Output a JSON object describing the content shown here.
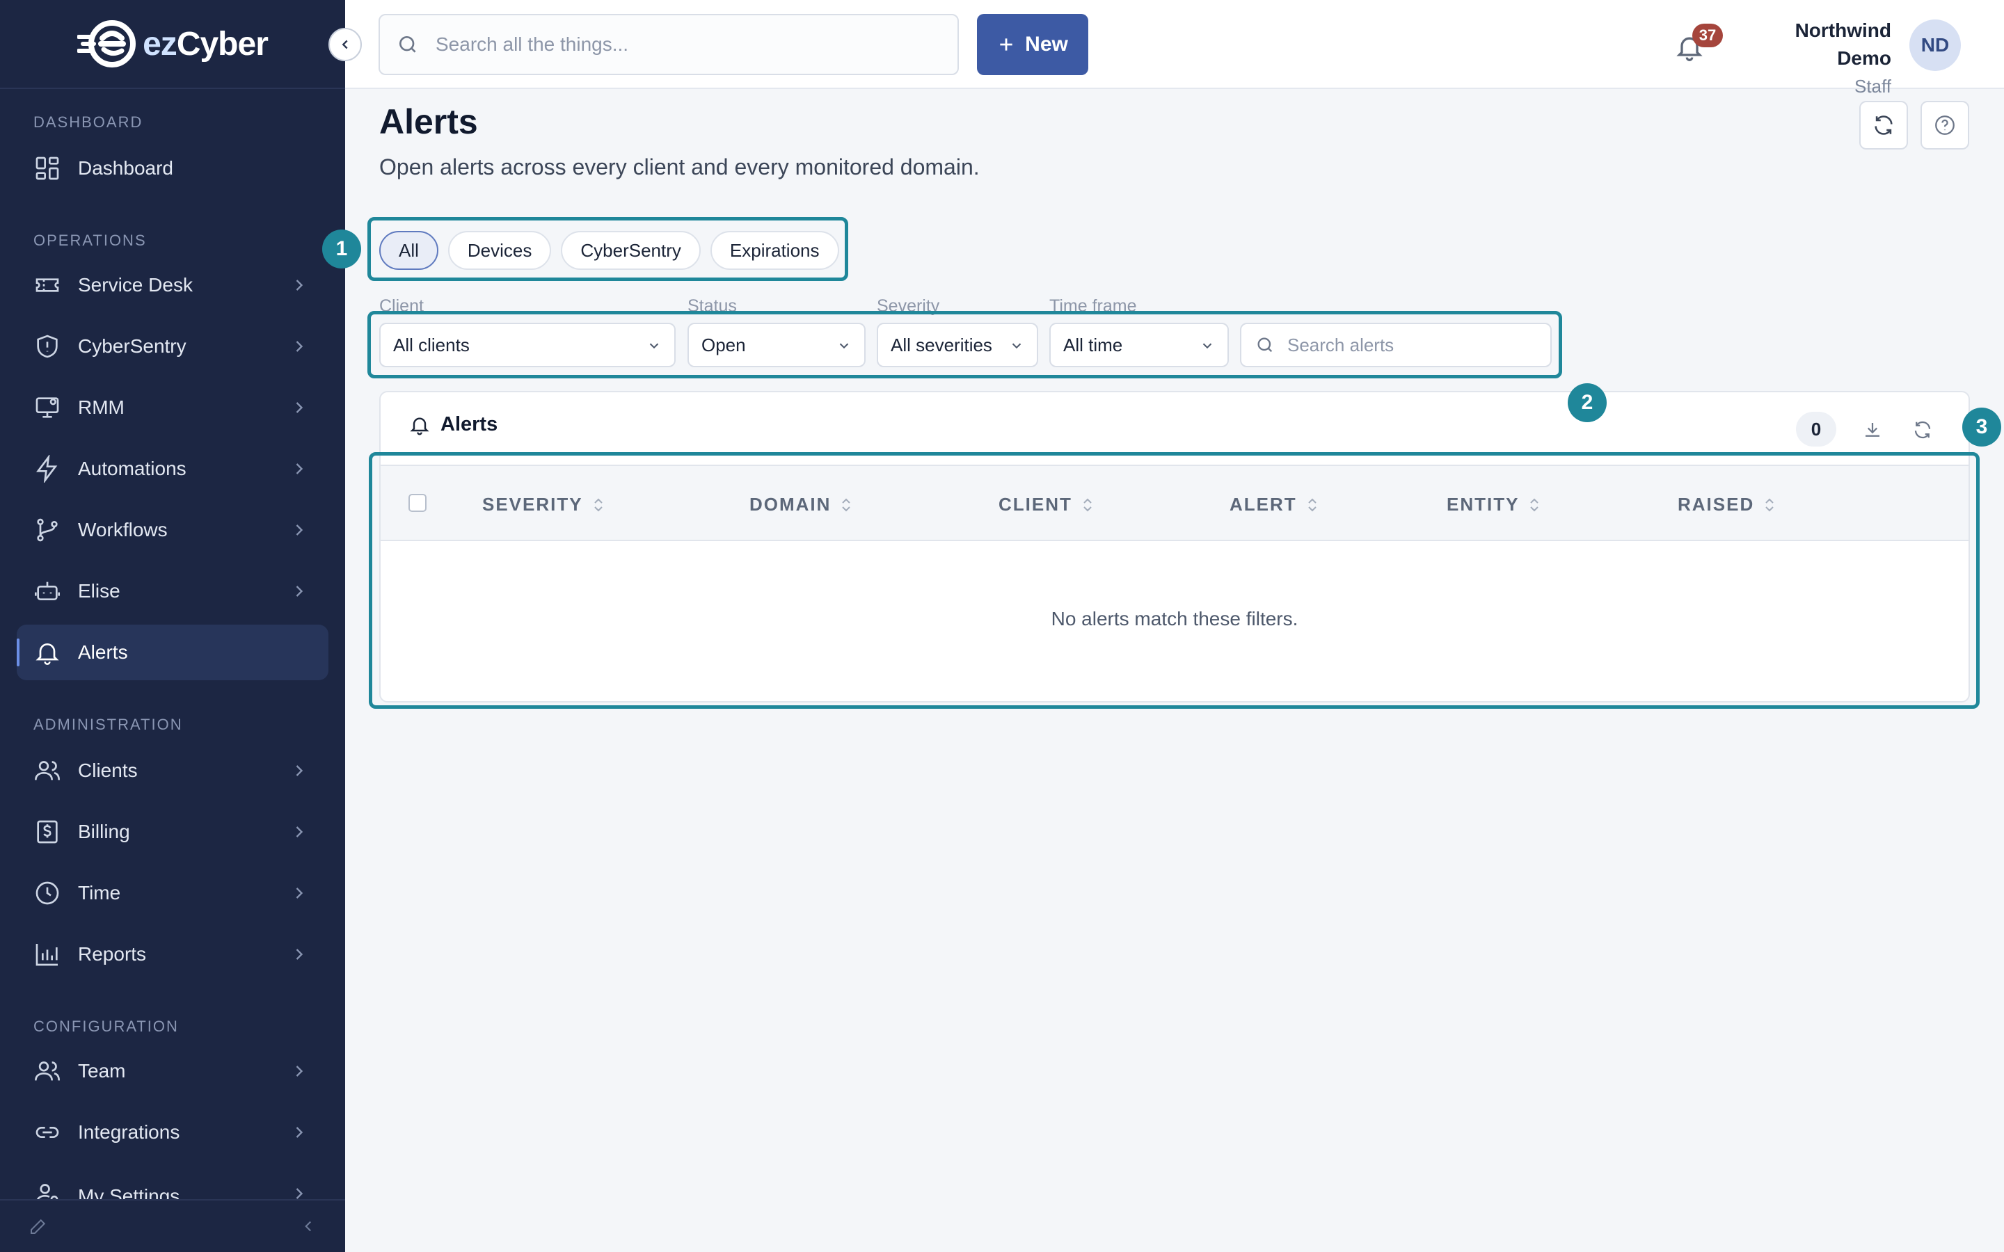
{
  "brand": {
    "prefix": "ez",
    "name": "Cyber"
  },
  "sidebar": {
    "sections": [
      {
        "label": "DASHBOARD"
      },
      {
        "label": "OPERATIONS"
      },
      {
        "label": "ADMINISTRATION"
      },
      {
        "label": "CONFIGURATION"
      }
    ],
    "items": [
      {
        "label": "Dashboard",
        "icon": "dashboard-icon"
      },
      {
        "label": "Service Desk",
        "icon": "ticket-icon"
      },
      {
        "label": "CyberSentry",
        "icon": "shield-icon"
      },
      {
        "label": "RMM",
        "icon": "monitor-icon"
      },
      {
        "label": "Automations",
        "icon": "lightning-icon"
      },
      {
        "label": "Workflows",
        "icon": "branch-icon"
      },
      {
        "label": "Elise",
        "icon": "robot-icon"
      },
      {
        "label": "Alerts",
        "icon": "bell-icon",
        "active": true
      },
      {
        "label": "Clients",
        "icon": "users-icon"
      },
      {
        "label": "Billing",
        "icon": "dollar-icon"
      },
      {
        "label": "Time",
        "icon": "clock-icon"
      },
      {
        "label": "Reports",
        "icon": "bar-chart-icon"
      },
      {
        "label": "Team",
        "icon": "team-icon"
      },
      {
        "label": "Integrations",
        "icon": "link-icon"
      },
      {
        "label": "My Settings",
        "icon": "user-settings-icon"
      }
    ]
  },
  "topbar": {
    "search_placeholder": "Search all the things...",
    "new_label": "New",
    "notification_count": "37",
    "user_name": "Northwind Demo",
    "user_role": "Staff",
    "avatar_initials": "ND"
  },
  "page": {
    "title": "Alerts",
    "subtitle": "Open alerts across every client and every monitored domain."
  },
  "tabs": [
    {
      "label": "All",
      "active": true
    },
    {
      "label": "Devices"
    },
    {
      "label": "CyberSentry"
    },
    {
      "label": "Expirations"
    }
  ],
  "filters": {
    "client": {
      "label": "Client",
      "value": "All clients"
    },
    "status": {
      "label": "Status",
      "value": "Open"
    },
    "severity": {
      "label": "Severity",
      "value": "All severities"
    },
    "timeframe": {
      "label": "Time frame",
      "value": "All time"
    },
    "search_placeholder": "Search alerts"
  },
  "annotations": [
    "1",
    "2",
    "3"
  ],
  "card": {
    "title": "Alerts",
    "count": "0",
    "columns": [
      "SEVERITY",
      "DOMAIN",
      "CLIENT",
      "ALERT",
      "ENTITY",
      "RAISED"
    ],
    "empty_message": "No alerts match these filters."
  },
  "colors": {
    "sidebar_bg": "#1c2643",
    "accent": "#3d5aa4",
    "annotation": "#1f879a",
    "badge": "#a5453c"
  }
}
